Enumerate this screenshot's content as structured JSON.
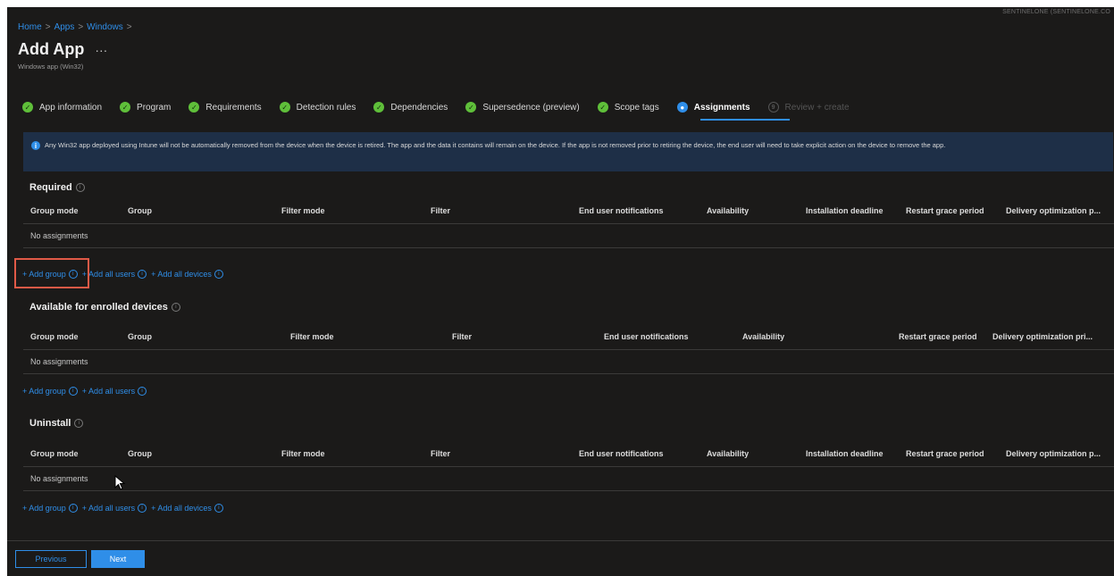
{
  "tenant": "SENTINELONE (SENTINELONE.CO",
  "breadcrumb": {
    "home": "Home",
    "apps": "Apps",
    "windows": "Windows",
    "sep": ">"
  },
  "page": {
    "title": "Add App",
    "more": "···",
    "subtitle": "Windows app (Win32)"
  },
  "steps": [
    {
      "label": "App information",
      "state": "done"
    },
    {
      "label": "Program",
      "state": "done"
    },
    {
      "label": "Requirements",
      "state": "done"
    },
    {
      "label": "Detection rules",
      "state": "done"
    },
    {
      "label": "Dependencies",
      "state": "done"
    },
    {
      "label": "Supersedence (preview)",
      "state": "done"
    },
    {
      "label": "Scope tags",
      "state": "done"
    },
    {
      "label": "Assignments",
      "state": "current"
    },
    {
      "label": "Review + create",
      "state": "disabled"
    }
  ],
  "banner": {
    "text": "Any Win32 app deployed using Intune will not be automatically removed from the device when the device is retired. The app and the data it contains will remain on the device. If the app is not removed prior to retiring the device, the end user will need to take explicit action on the device to remove the app."
  },
  "empty_text": "No assignments",
  "sections": {
    "required": {
      "title": "Required",
      "columns": [
        "Group mode",
        "Group",
        "Filter mode",
        "Filter",
        "End user notifications",
        "Availability",
        "Installation deadline",
        "Restart grace period",
        "Delivery optimization p..."
      ],
      "links": [
        "+ Add group",
        "+ Add all users",
        "+ Add all devices"
      ]
    },
    "available": {
      "title": "Available for enrolled devices",
      "columns": [
        "Group mode",
        "Group",
        "Filter mode",
        "Filter",
        "End user notifications",
        "Availability",
        "Restart grace period",
        "Delivery optimization pri..."
      ],
      "links": [
        "+ Add group",
        "+ Add all users"
      ]
    },
    "uninstall": {
      "title": "Uninstall",
      "columns": [
        "Group mode",
        "Group",
        "Filter mode",
        "Filter",
        "End user notifications",
        "Availability",
        "Installation deadline",
        "Restart grace period",
        "Delivery optimization p..."
      ],
      "links": [
        "+ Add group",
        "+ Add all users",
        "+ Add all devices"
      ]
    }
  },
  "footer": {
    "previous": "Previous",
    "next": "Next"
  },
  "colors": {
    "accent": "#2f8ee8",
    "success": "#5fbf3a",
    "highlight": "#e05a47",
    "background": "#1b1a19"
  }
}
